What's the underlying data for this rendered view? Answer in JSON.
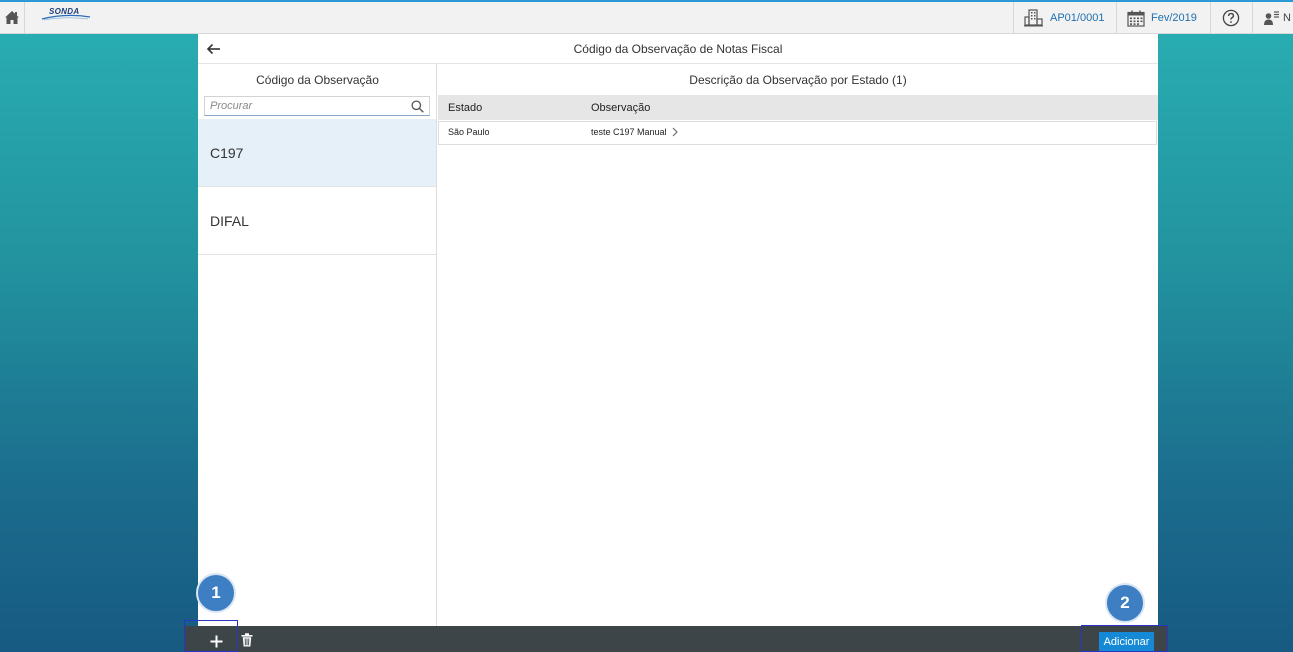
{
  "topbar": {
    "logo_text": "SONDA",
    "company_code": "AP01/0001",
    "period": "Fev/2019",
    "user_initial": "N"
  },
  "panel": {
    "title": "Código da Observação de Notas Fiscal"
  },
  "master": {
    "title": "Código da Observação",
    "search_placeholder": "Procurar",
    "items": [
      {
        "label": "C197"
      },
      {
        "label": "DIFAL"
      }
    ]
  },
  "detail": {
    "title": "Descrição da Observação por Estado (1)",
    "columns": [
      "Estado",
      "Observação"
    ],
    "rows": [
      {
        "estado": "São Paulo",
        "observacao": "teste C197 Manual"
      }
    ]
  },
  "footer": {
    "add_label": "Adicionar"
  },
  "annotations": {
    "badge_1": "1",
    "badge_2": "2"
  },
  "colors": {
    "accent": "#1689d6",
    "footer_bg": "#3e4548",
    "selected_bg": "#e5f0f8",
    "badge_bg": "#3e7ec3",
    "highlight_border": "#2b35c4"
  }
}
